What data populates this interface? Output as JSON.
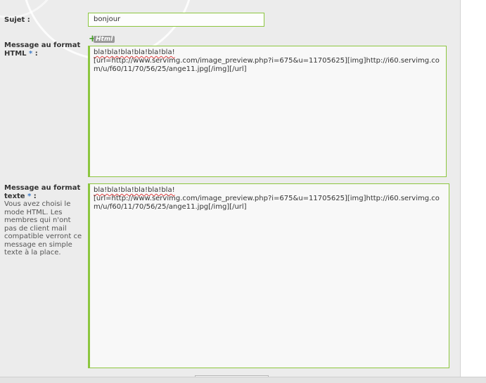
{
  "form": {
    "subject": {
      "label": "Sujet :",
      "value": "bonjour"
    },
    "html_message": {
      "label": "Message au format HTML",
      "required_marker": "*",
      "label_colon": ":",
      "badge": "Html",
      "line1": "bla!bla!bla!bla!bla!bla!",
      "line2": "[url=http://www.servimg.com/image_preview.php?i=675&u=11705625][img]http://i60.servimg.com/u/f60/11/70/56/25/ange11.jpg[/img][/url]"
    },
    "text_message": {
      "label": "Message au format texte",
      "required_marker": "*",
      "label_colon": ":",
      "help": "Vous avez choisi le mode HTML. Les membres qui n'ont pas de client mail compatible verront ce message en simple texte à la place.",
      "line1": "bla!bla!bla!bla!bla!bla!",
      "line2": "[url=http://www.servimg.com/image_preview.php?i=675&u=11705625][img]http://i60.servimg.com/u/f60/11/70/56/25/ange11.jpg[/img][/url]"
    }
  }
}
